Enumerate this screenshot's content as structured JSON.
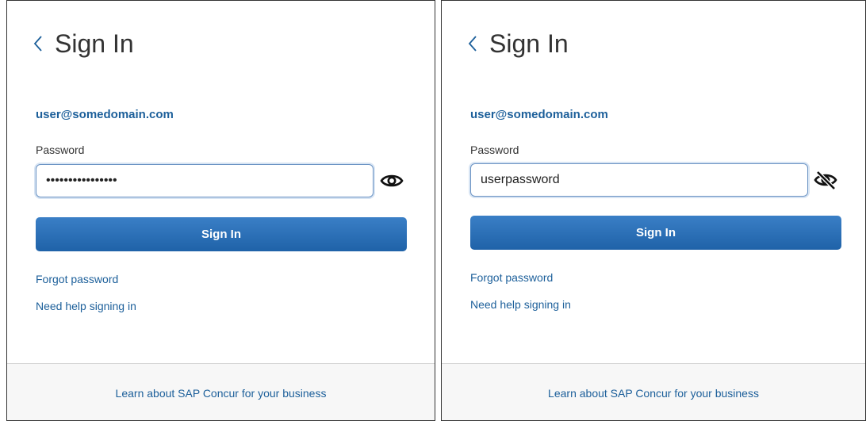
{
  "panels": [
    {
      "id": "masked",
      "title": "Sign In",
      "email": "user@somedomain.com",
      "password_label": "Password",
      "password_value": "••••••••••••••••",
      "eye_icon": "eye-icon",
      "signin_label": "Sign In",
      "forgot_link": "Forgot password",
      "help_link": "Need help signing in",
      "footer_link": "Learn about SAP Concur for your business"
    },
    {
      "id": "revealed",
      "title": "Sign In",
      "email": "user@somedomain.com",
      "password_label": "Password",
      "password_value": "userpassword",
      "eye_icon": "eye-slash-icon",
      "signin_label": "Sign In",
      "forgot_link": "Forgot password",
      "help_link": "Need help signing in",
      "footer_link": "Learn about SAP Concur for your business"
    }
  ],
  "colors": {
    "link": "#1c5f9a",
    "button": "#2a6fb5",
    "input_border": "#6c94c4"
  }
}
